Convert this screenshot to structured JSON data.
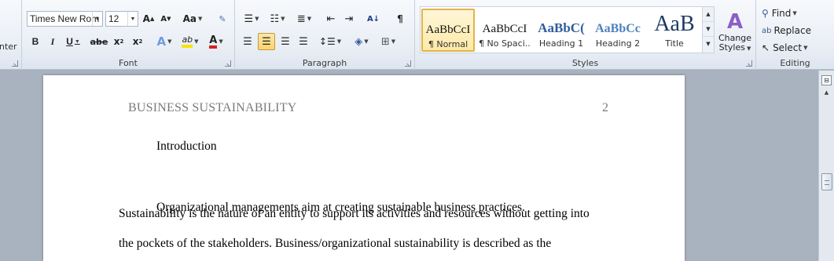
{
  "ribbon": {
    "clipboard_partial_label": "nter",
    "font": {
      "label": "Font",
      "font_name": "Times New Rom",
      "font_size": "12",
      "grow_glyph": "A",
      "shrink_glyph": "A",
      "change_case_glyph": "Aa",
      "bold": "B",
      "italic": "I",
      "underline": "U",
      "strike": "abe",
      "subscript": "x",
      "superscript": "x",
      "text_effects_glyph": "A",
      "highlight_glyph": "ab",
      "font_color_glyph": "A",
      "highlight_color": "#f6e400",
      "font_color": "#d62020"
    },
    "paragraph": {
      "label": "Paragraph",
      "show_marks_glyph": "¶"
    },
    "styles": {
      "label": "Styles",
      "items": [
        {
          "sample": "AaBbCcI",
          "name": "¶ Normal"
        },
        {
          "sample": "AaBbCcI",
          "name": "¶ No Spaci..."
        },
        {
          "sample": "AaBbC(",
          "name": "Heading 1"
        },
        {
          "sample": "AaBbCc",
          "name": "Heading 2"
        },
        {
          "sample": "AaB",
          "name": "Title"
        }
      ],
      "change_styles_line1": "Change",
      "change_styles_line2": "Styles",
      "heading_color": "#2f5d9b"
    },
    "editing": {
      "label": "Editing",
      "find": "Find",
      "replace": "Replace",
      "select": "Select"
    }
  },
  "document": {
    "header_title": "BUSINESS SUSTAINABILITY",
    "page_number": "2",
    "lines": [
      "Introduction",
      "Organizational managements aim at creating sustainable business practices.",
      "Sustainability is the nature of an entity to support its activities and resources without getting into",
      "the pockets of the stakeholders. Business/organizational  sustainability is described as the"
    ]
  }
}
